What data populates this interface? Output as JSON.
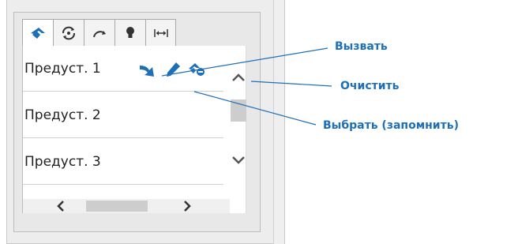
{
  "tabs": [
    {
      "icon": "preset-flag-icon",
      "active": true
    },
    {
      "icon": "rotate-cycle-icon",
      "active": false
    },
    {
      "icon": "arc-arrow-icon",
      "active": false
    },
    {
      "icon": "bulb-icon",
      "active": false
    },
    {
      "icon": "expand-width-icon",
      "active": false
    }
  ],
  "presets": [
    {
      "label": "Предуст. 1"
    },
    {
      "label": "Предуст. 2"
    },
    {
      "label": "Предуст. 3"
    }
  ],
  "row_actions": {
    "recall_icon": "recall-arrow-icon",
    "save_icon": "pencil-icon",
    "clear_icon": "clear-preset-icon"
  },
  "callouts": {
    "recall": "Вызвать",
    "clear": "Очистить",
    "save": "Выбрать (запомнить)"
  },
  "colors": {
    "accent": "#1d6fb8",
    "callout_line": "#1d6fb8"
  }
}
